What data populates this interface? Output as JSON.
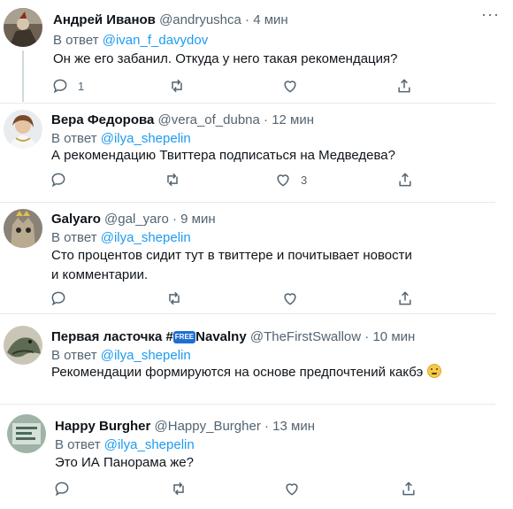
{
  "tweets": [
    {
      "name": "Андрей Иванов",
      "handle": "@andryushca",
      "sep": "·",
      "time": "4 мин",
      "reply_prefix": "В ответ",
      "reply_to": "@ivan_f_davydov",
      "text": "Он же его забанил. Откуда у него такая рекомендация?",
      "reply_count": "1",
      "retweet_count": "",
      "like_count": ""
    },
    {
      "name": "Вера Федорова",
      "handle": "@vera_of_dubna",
      "sep": "·",
      "time": "12 мин",
      "reply_prefix": "В ответ",
      "reply_to": "@ilya_shepelin",
      "text": "А рекомендацию Твиттера подписаться на Медведева?",
      "reply_count": "",
      "retweet_count": "",
      "like_count": "3"
    },
    {
      "name": "Galyaro",
      "handle": "@gal_yaro",
      "sep": "·",
      "time": "9 мин",
      "reply_prefix": "В ответ",
      "reply_to": "@ilya_shepelin",
      "text": "Сто процентов сидит тут в твиттере и почитывает новости и комментарии.",
      "reply_count": "",
      "retweet_count": "",
      "like_count": ""
    },
    {
      "name_part1": "Первая ласточка #",
      "badge": "FREE",
      "name_part2": "Navalny",
      "handle": "@TheFirstSwallow",
      "sep": "·",
      "time": "10 мин",
      "reply_prefix": "В ответ",
      "reply_to": "@ilya_shepelin",
      "text": "Рекомендации формируются на основе предпочтений какбэ",
      "emoji": "thinking-face-icon",
      "reply_count": "",
      "retweet_count": "",
      "like_count": ""
    },
    {
      "name": "Happy Burgher",
      "handle": "@Happy_Burgher",
      "sep": "·",
      "time": "13 мин",
      "reply_prefix": "В ответ",
      "reply_to": "@ilya_shepelin",
      "text": "Это ИА Панорама же?",
      "reply_count": "",
      "retweet_count": "",
      "like_count": ""
    }
  ],
  "more_glyph": "···",
  "colors": {
    "link": "#1d9bf0",
    "secondary": "#536471",
    "divider": "#e6e9ec",
    "thread_line": "#cfd9de"
  },
  "icons": [
    "reply-icon",
    "retweet-icon",
    "like-icon",
    "share-icon",
    "more-icon"
  ]
}
